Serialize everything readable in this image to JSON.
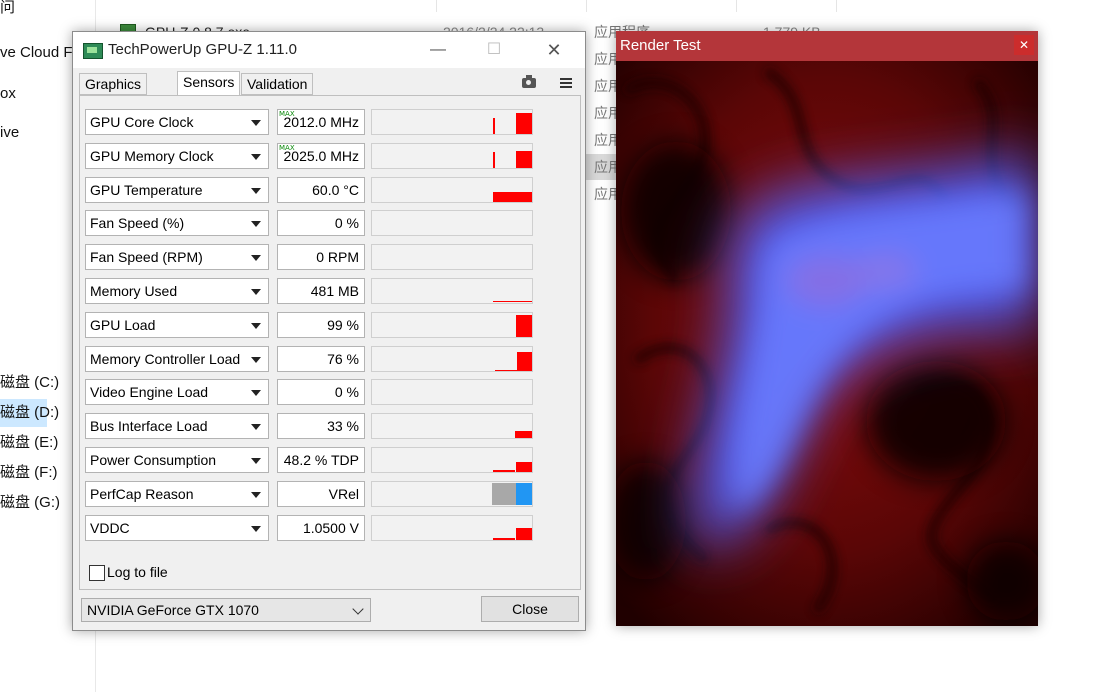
{
  "explorer": {
    "nav": [
      {
        "label": "问",
        "top": 0
      },
      {
        "label": "ve Cloud Fi"
      },
      {
        "label": "ox"
      },
      {
        "label": "ive"
      },
      {
        "label": "磁盘 (C:)"
      },
      {
        "label": "磁盘 (D:)"
      },
      {
        "label": "磁盘 (E:)"
      },
      {
        "label": "磁盘 (F:)"
      },
      {
        "label": "磁盘 (G:)"
      }
    ],
    "files": [
      {
        "name": "GPU-Z.0.8.7.exe",
        "date": "2016/2/24 22:13",
        "type": "应用程序",
        "size": "1,779 KB"
      },
      {
        "type": "应用程序"
      },
      {
        "type": "应用程序"
      },
      {
        "type": "应用程序"
      },
      {
        "type": "应用程序"
      },
      {
        "type": "应用程序"
      },
      {
        "type": "应用程序"
      }
    ]
  },
  "gpuz": {
    "title": "TechPowerUp GPU-Z 1.11.0",
    "close_glyph": "✕",
    "min_glyph": "—",
    "max_glyph": "☐",
    "tabs": [
      "Graphics Card",
      "Sensors",
      "Validation"
    ],
    "active_tab": "Sensors",
    "sensors": [
      {
        "name": "GPU Core Clock",
        "value": "2012.0 MHz",
        "max": "MAX"
      },
      {
        "name": "GPU Memory Clock",
        "value": "2025.0 MHz",
        "max": "MAX"
      },
      {
        "name": "GPU Temperature",
        "value": "60.0 °C"
      },
      {
        "name": "Fan Speed (%)",
        "value": "0 %"
      },
      {
        "name": "Fan Speed (RPM)",
        "value": "0 RPM"
      },
      {
        "name": "Memory Used",
        "value": "481 MB"
      },
      {
        "name": "GPU Load",
        "value": "99 %"
      },
      {
        "name": "Memory Controller Load",
        "value": "76 %"
      },
      {
        "name": "Video Engine Load",
        "value": "0 %"
      },
      {
        "name": "Bus Interface Load",
        "value": "33 %"
      },
      {
        "name": "Power Consumption",
        "value": "48.2 % TDP"
      },
      {
        "name": "PerfCap Reason",
        "value": "VRel"
      },
      {
        "name": "VDDC",
        "value": "1.0500 V"
      }
    ],
    "log_to_file": "Log to file",
    "log_checked": false,
    "gpu_selected": "NVIDIA GeForce GTX 1070",
    "close_button": "Close",
    "graph_color": "#ff0000"
  },
  "render": {
    "title": "Render Test",
    "close_glyph": "✕"
  }
}
